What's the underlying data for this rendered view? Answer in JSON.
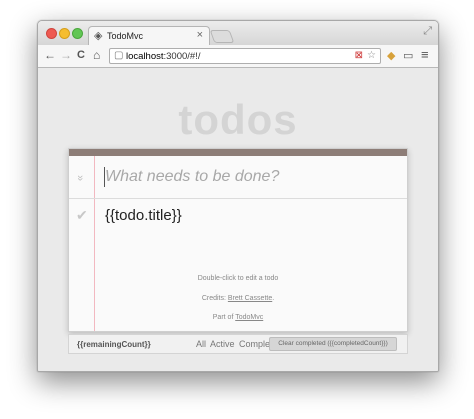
{
  "browser": {
    "tab_title": "TodoMvc",
    "tab_close": "×",
    "tab_icon": "angular-icon",
    "url_host": "localhost",
    "url_rest": ":3000/#!/",
    "nav_back": "←",
    "nav_forward": "→",
    "nav_reload": "C",
    "nav_home": "⌂",
    "page_icon": "▢",
    "menu": "≡"
  },
  "app": {
    "brand": "todos",
    "toggle_all": "»",
    "new_todo_placeholder": "What needs to be done?",
    "todo": {
      "check": "✔",
      "title": "{{todo.title}}"
    },
    "info": {
      "line1": "Double-click to edit a todo",
      "credits_prefix": "Credits: ",
      "credits_name": "Brett Cassette",
      "credits_suffix": ".",
      "part_of_prefix": "Part of ",
      "part_of_link": "TodoMvc"
    },
    "footer": {
      "remaining": "{{remainingCount}}",
      "filters": [
        "All",
        "Active",
        "Completed"
      ],
      "clear_completed": "Clear completed ({{completedCount}})"
    }
  },
  "colors": {
    "header_bar": "#8d7d77",
    "brand_text": "#d4d4d4",
    "margin_line": "#f2b8c0"
  }
}
